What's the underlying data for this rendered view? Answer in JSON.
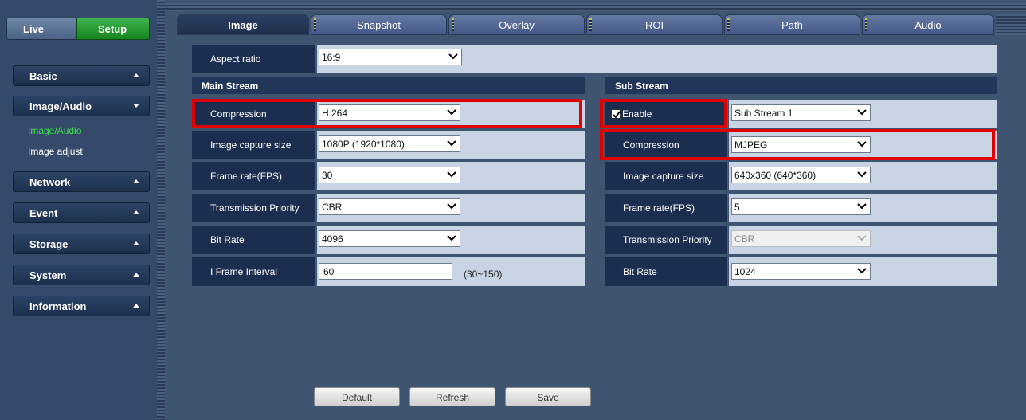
{
  "nav": {
    "live": "Live",
    "setup": "Setup"
  },
  "menu": [
    {
      "label": "Basic"
    },
    {
      "label": "Image/Audio"
    },
    {
      "label": "Network"
    },
    {
      "label": "Event"
    },
    {
      "label": "Storage"
    },
    {
      "label": "System"
    },
    {
      "label": "Information"
    }
  ],
  "submenu": {
    "active": "Image/Audio",
    "other": "Image adjust"
  },
  "tabs": [
    "Image",
    "Snapshot",
    "Overlay",
    "ROI",
    "Path",
    "Audio"
  ],
  "aspect": {
    "label": "Aspect ratio",
    "value": "16:9"
  },
  "main": {
    "title": "Main Stream",
    "rows": [
      {
        "label": "Compression",
        "value": "H.264"
      },
      {
        "label": "Image capture size",
        "value": "1080P (1920*1080)"
      },
      {
        "label": "Frame rate(FPS)",
        "value": "30"
      },
      {
        "label": "Transmission Priority",
        "value": "CBR"
      },
      {
        "label": "Bit Rate",
        "value": "4096"
      },
      {
        "label": "I Frame Interval",
        "value": "60",
        "hint": "(30~150)"
      }
    ]
  },
  "sub": {
    "title": "Sub Stream",
    "rows": [
      {
        "label": "Enable",
        "value": "Sub Stream 1",
        "checked": true
      },
      {
        "label": "Compression",
        "value": "MJPEG"
      },
      {
        "label": "Image capture size",
        "value": "640x360 (640*360)"
      },
      {
        "label": "Frame rate(FPS)",
        "value": "5"
      },
      {
        "label": "Transmission Priority",
        "value": "CBR",
        "disabled": true
      },
      {
        "label": "Bit Rate",
        "value": "1024"
      }
    ]
  },
  "buttons": {
    "default": "Default",
    "refresh": "Refresh",
    "save": "Save"
  },
  "colors": {
    "highlight": "#e00000",
    "active_menu": "#3de54c",
    "setup_tab": "#18851f"
  }
}
